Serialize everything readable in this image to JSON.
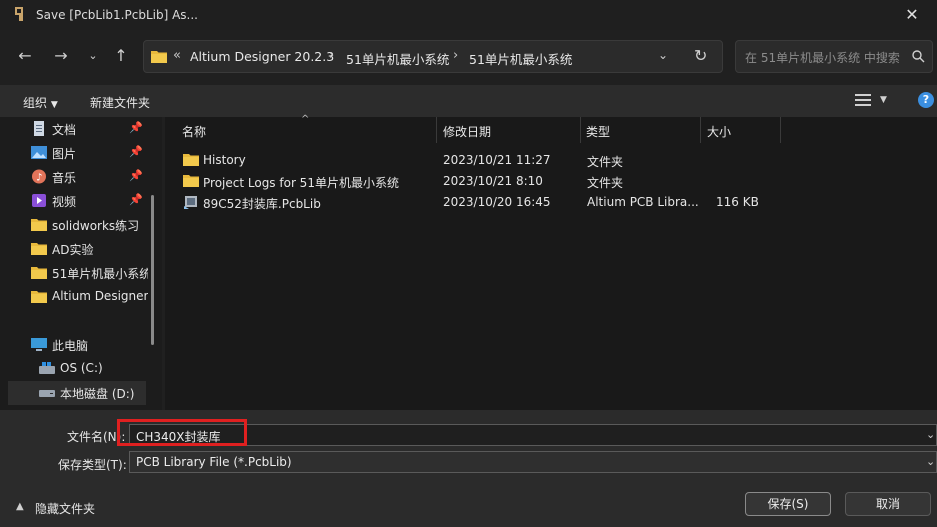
{
  "window": {
    "title": "Save [PcbLib1.PcbLib] As..."
  },
  "address": {
    "overflow": "«",
    "crumbs": [
      "Altium Designer 20.2.3",
      "51单片机最小系统",
      "51单片机最小系统"
    ]
  },
  "search": {
    "placeholder": "在 51单片机最小系统 中搜索"
  },
  "toolbar": {
    "organize": "组织",
    "new_folder": "新建文件夹"
  },
  "sidebar": {
    "items": [
      {
        "label": "文档",
        "icon": "document-icon",
        "pinned": true
      },
      {
        "label": "图片",
        "icon": "picture-icon",
        "pinned": true
      },
      {
        "label": "音乐",
        "icon": "music-icon",
        "pinned": true
      },
      {
        "label": "视频",
        "icon": "video-icon",
        "pinned": true
      },
      {
        "label": "solidworks练习",
        "icon": "folder-icon",
        "pinned": false
      },
      {
        "label": "AD实验",
        "icon": "folder-icon",
        "pinned": false
      },
      {
        "label": "51单片机最小系统",
        "icon": "folder-icon",
        "pinned": false
      },
      {
        "label": "Altium Designer",
        "icon": "folder-icon",
        "pinned": false
      }
    ],
    "this_pc": "此电脑",
    "drives": [
      {
        "label": "OS (C:)",
        "icon": "windows-drive-icon"
      },
      {
        "label": "本地磁盘 (D:)",
        "icon": "drive-icon"
      }
    ]
  },
  "columns": {
    "name": "名称",
    "date": "修改日期",
    "type": "类型",
    "size": "大小"
  },
  "files": [
    {
      "name": "History",
      "date": "2023/10/21 11:27",
      "type": "文件夹",
      "size": "",
      "icon": "folder-icon"
    },
    {
      "name": "Project Logs for 51单片机最小系统",
      "date": "2023/10/21 8:10",
      "type": "文件夹",
      "size": "",
      "icon": "folder-icon"
    },
    {
      "name": "89C52封装库.PcbLib",
      "date": "2023/10/20 16:45",
      "type": "Altium PCB Libra...",
      "size": "116 KB",
      "icon": "pcblib-file-icon"
    }
  ],
  "form": {
    "filename_label": "文件名(N):",
    "filename_value": "CH340X封装库",
    "filetype_label": "保存类型(T):",
    "filetype_value": "PCB Library File (*.PcbLib)"
  },
  "buttons": {
    "hide_folders": "隐藏文件夹",
    "save": "保存(S)",
    "cancel": "取消"
  },
  "colors": {
    "highlight_box": "#e02020",
    "folder": "#e8b93c",
    "help": "#3b8fe0"
  }
}
